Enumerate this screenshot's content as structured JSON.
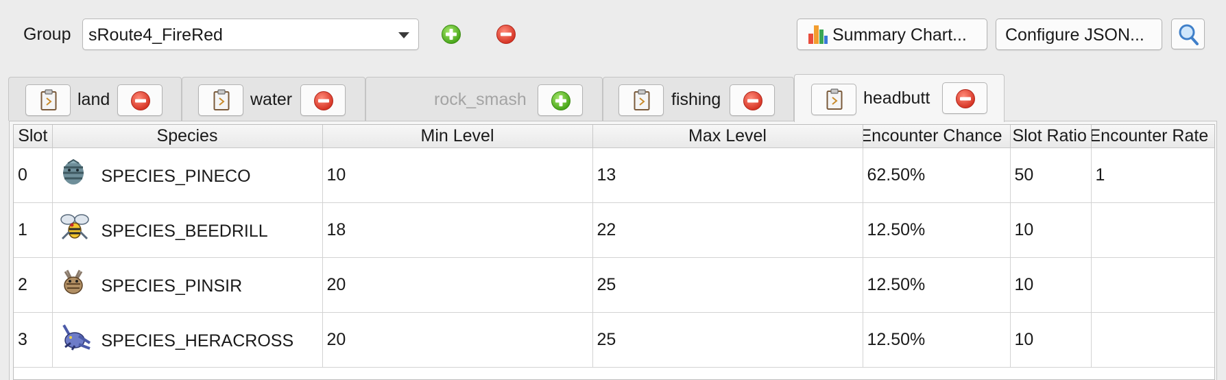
{
  "toolbar": {
    "group_label": "Group",
    "group_value": "sRoute4_FireRed",
    "summary_label": "Summary Chart...",
    "configure_label": "Configure JSON..."
  },
  "tabs": [
    {
      "label": "land",
      "state": "enabled",
      "action": "remove"
    },
    {
      "label": "water",
      "state": "enabled",
      "action": "remove"
    },
    {
      "label": "rock_smash",
      "state": "disabled",
      "action": "add"
    },
    {
      "label": "fishing",
      "state": "enabled",
      "action": "remove"
    },
    {
      "label": "headbutt",
      "state": "active",
      "action": "remove"
    }
  ],
  "table": {
    "columns": [
      "Slot",
      "Species",
      "Min Level",
      "Max Level",
      "Encounter Chance",
      "Slot Ratio",
      "Encounter Rate"
    ],
    "rows": [
      {
        "slot": "0",
        "species": "SPECIES_PINECO",
        "min": "10",
        "max": "13",
        "chance": "62.50%",
        "ratio": "50",
        "rate": "1"
      },
      {
        "slot": "1",
        "species": "SPECIES_BEEDRILL",
        "min": "18",
        "max": "22",
        "chance": "12.50%",
        "ratio": "10",
        "rate": ""
      },
      {
        "slot": "2",
        "species": "SPECIES_PINSIR",
        "min": "20",
        "max": "25",
        "chance": "12.50%",
        "ratio": "10",
        "rate": ""
      },
      {
        "slot": "3",
        "species": "SPECIES_HERACROSS",
        "min": "20",
        "max": "25",
        "chance": "12.50%",
        "ratio": "10",
        "rate": ""
      }
    ]
  },
  "colors": {
    "add_green": "#5cc02a",
    "remove_red": "#e8493b",
    "window_bg": "#ececec"
  },
  "icons": {
    "add": "green-plus-circle",
    "remove": "red-minus-circle",
    "clipboard": "clipboard-icon",
    "chart": "bar-chart-icon",
    "search": "magnifier-icon"
  }
}
